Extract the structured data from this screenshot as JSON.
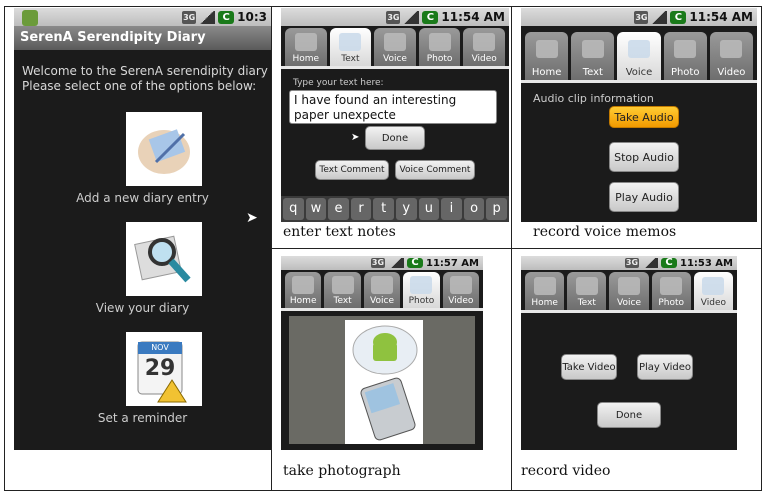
{
  "panel1": {
    "status_time": "10:3",
    "app_title": "SerenA Serendipity Diary",
    "welcome_line1": "Welcome to the SerenA serendipity diary",
    "welcome_line2": "Please select one of the options below:",
    "options": [
      {
        "label": "Add a new diary entry",
        "icon": "diary-entry-icon"
      },
      {
        "label": "View your diary",
        "icon": "magnifier-icon"
      },
      {
        "label": "Set a reminder",
        "icon": "calendar-icon",
        "calendar_day": "29",
        "calendar_month": "NOV"
      }
    ]
  },
  "panel2": {
    "status_time": "11:54 AM",
    "tabs": [
      "Home",
      "Text",
      "Voice",
      "Photo",
      "Video"
    ],
    "active_tab": "Text",
    "input_label": "Type your text here:",
    "input_value": "I have found an interesting paper unexpecte",
    "done_label": "Done",
    "text_comment_label": "Text Comment",
    "voice_comment_label": "Voice Comment",
    "keyboard_keys": [
      "q",
      "w",
      "e",
      "r",
      "t",
      "y",
      "u",
      "i",
      "o",
      "p"
    ],
    "caption": "enter text notes"
  },
  "panel3": {
    "status_time": "11:54 AM",
    "tabs": [
      "Home",
      "Text",
      "Voice",
      "Photo",
      "Video"
    ],
    "active_tab": "Voice",
    "info_label": "Audio clip information",
    "take_audio_label": "Take Audio",
    "stop_audio_label": "Stop Audio",
    "play_audio_label": "Play Audio",
    "caption": "record voice memos"
  },
  "panel4": {
    "status_time": "11:57 AM",
    "tabs": [
      "Home",
      "Text",
      "Voice",
      "Photo",
      "Video"
    ],
    "active_tab": "Photo",
    "caption": "take photograph"
  },
  "panel5": {
    "status_time": "11:53 AM",
    "tabs": [
      "Home",
      "Text",
      "Voice",
      "Photo",
      "Video"
    ],
    "active_tab": "Video",
    "take_video_label": "Take Video",
    "play_video_label": "Play Video",
    "done_label": "Done",
    "caption": "record video"
  }
}
